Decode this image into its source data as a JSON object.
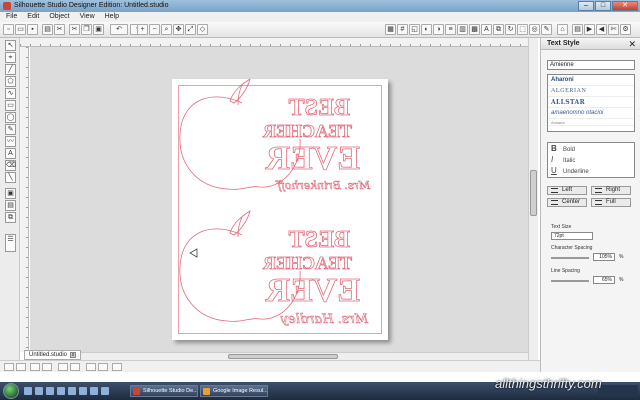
{
  "window": {
    "title": "Silhouette Studio Designer Edition: Untitled.studio",
    "minimize": "–",
    "maximize": "□",
    "close": "✕"
  },
  "menu": [
    "File",
    "Edit",
    "Object",
    "View",
    "Help"
  ],
  "document_tab": {
    "label": "Untitled.studio"
  },
  "text_style_panel": {
    "title": "Text Style",
    "close": "✕",
    "font_field": "Amienne",
    "fonts": [
      "Aharoni",
      "ALGERIAN",
      "ALLSTAR",
      "amaenomno otacioi",
      "Amiana"
    ],
    "styles": [
      {
        "glyph": "B",
        "label": "Bold"
      },
      {
        "glyph": "I",
        "label": "Italic"
      },
      {
        "glyph": "U",
        "label": "Underline"
      }
    ],
    "align": {
      "left": "Left",
      "right": "Right",
      "center": "Center",
      "full": "Full"
    },
    "text_size_label": "Text Size",
    "text_size_value": "72pt",
    "char_spacing_label": "Character Spacing",
    "char_spacing_value": "105%",
    "line_spacing_label": "Line Spacing",
    "line_spacing_value": "65%",
    "percent": "%"
  },
  "design": {
    "line1": "BEST",
    "line2": "TEACHER",
    "line3": "EVER",
    "name_top": "Mrs. Brinkerhoff",
    "name_bottom": "Mrs. Hardley",
    "stroke_color": "#e46a7a"
  },
  "taskbar": {
    "items": [
      "Silhouette Studio De...",
      "Google Image Resul..."
    ]
  },
  "watermark": "allthingsthrifty.com",
  "colors": {
    "accent": "#e46a7a",
    "titlebar": "#9ec0dc",
    "taskbar": "#2b3a52"
  }
}
